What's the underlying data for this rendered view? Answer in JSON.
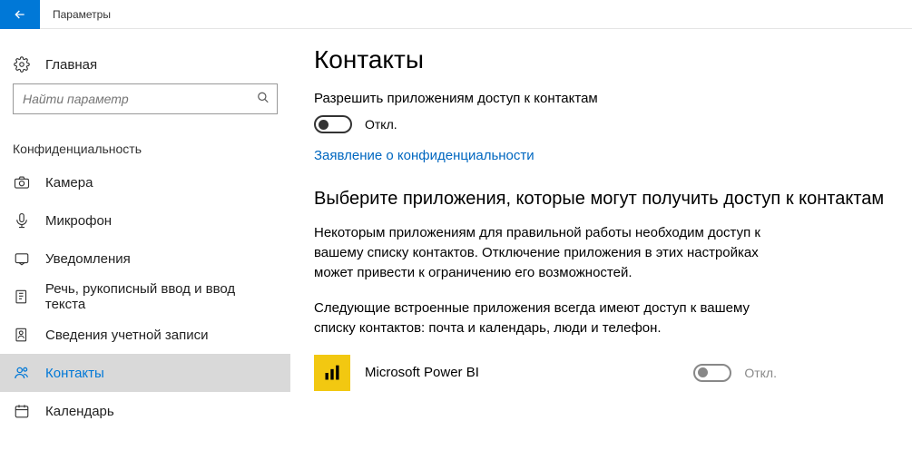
{
  "window": {
    "title": "Параметры"
  },
  "sidebar": {
    "home_label": "Главная",
    "search_placeholder": "Найти параметр",
    "section_label": "Конфиденциальность",
    "items": [
      {
        "label": "Камера"
      },
      {
        "label": "Микрофон"
      },
      {
        "label": "Уведомления"
      },
      {
        "label": "Речь, рукописный ввод и ввод текста"
      },
      {
        "label": "Сведения учетной записи"
      },
      {
        "label": "Контакты"
      },
      {
        "label": "Календарь"
      }
    ]
  },
  "main": {
    "heading": "Контакты",
    "allow_label": "Разрешить приложениям доступ к контактам",
    "master_toggle_state": "Откл.",
    "privacy_link": "Заявление о конфиденциальности",
    "section2_heading": "Выберите приложения, которые могут получить доступ к контактам",
    "para1": "Некоторым приложениям для правильной работы необходим доступ к вашему списку контактов. Отключение приложения в этих настройках может привести к ограничению его возможностей.",
    "para2": "Следующие встроенные приложения всегда имеют доступ к вашему списку контактов: почта и календарь, люди и телефон.",
    "app": {
      "name": "Microsoft Power BI",
      "toggle_state": "Откл."
    }
  }
}
